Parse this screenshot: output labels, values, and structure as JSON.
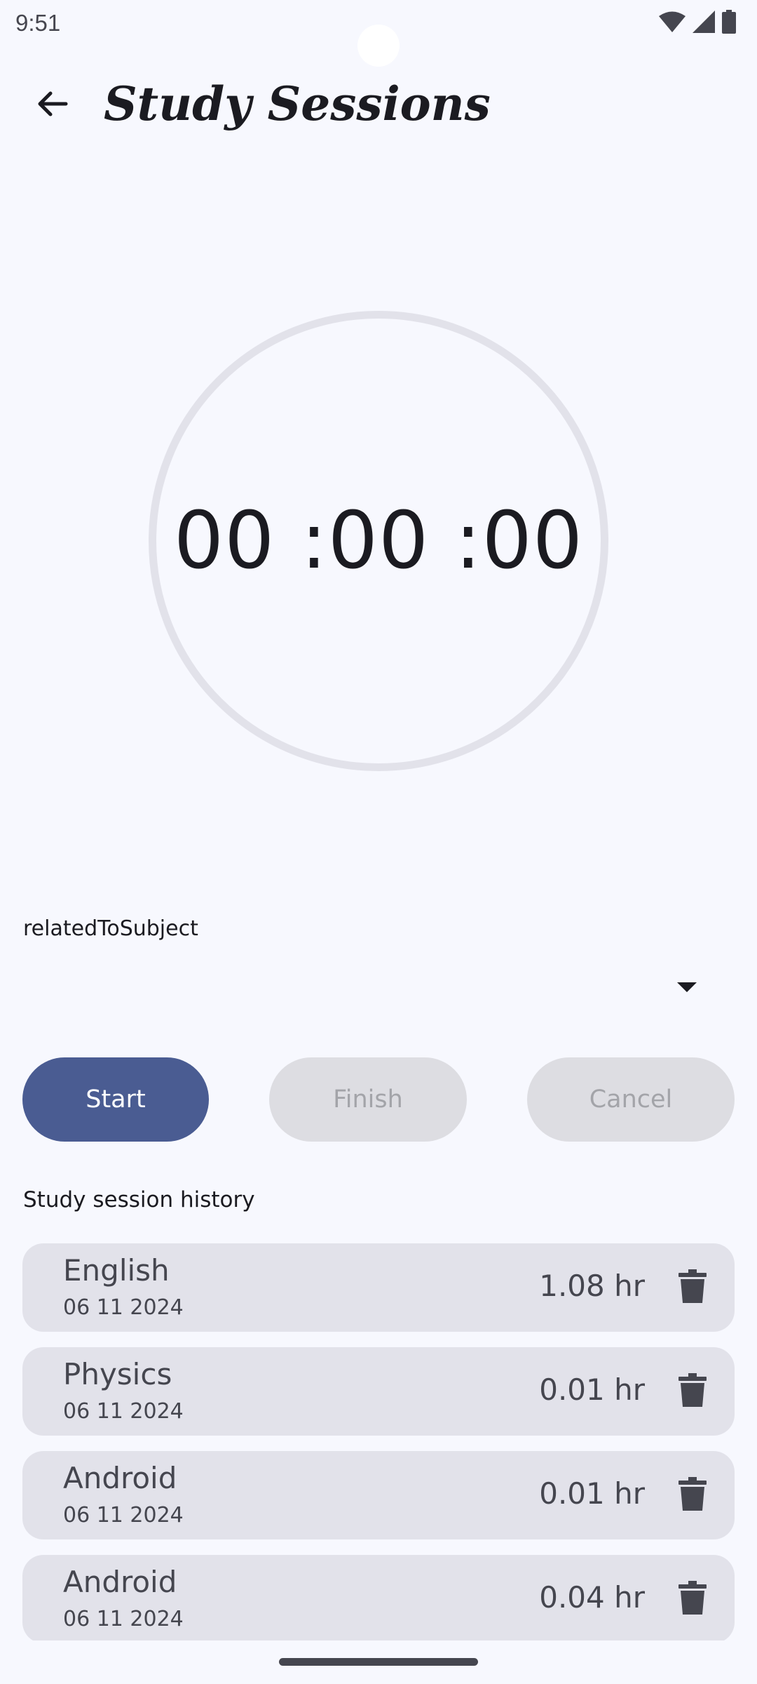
{
  "status_bar": {
    "time": "9:51"
  },
  "app_bar": {
    "title": "Study Sessions",
    "back_icon": "arrow-back-icon"
  },
  "timer": {
    "display": "00 :00 :00"
  },
  "subject_dropdown": {
    "label": "relatedToSubject",
    "selected_value": ""
  },
  "actions": {
    "start_label": "Start",
    "finish_label": "Finish",
    "cancel_label": "Cancel"
  },
  "history": {
    "title": "Study session history",
    "sessions": [
      {
        "subject": "English",
        "date": "06 11 2024",
        "duration": "1.08 hr"
      },
      {
        "subject": "Physics",
        "date": "06 11 2024",
        "duration": "0.01 hr"
      },
      {
        "subject": "Android",
        "date": "06 11 2024",
        "duration": "0.01 hr"
      },
      {
        "subject": "Android",
        "date": "06 11 2024",
        "duration": "0.04 hr"
      }
    ]
  },
  "colors": {
    "background": "#f7f8fe",
    "primary": "#4a5c92",
    "surface_variant": "#e2e2ea",
    "disabled_button": "#dddde2",
    "on_surface": "#1b1b21"
  }
}
